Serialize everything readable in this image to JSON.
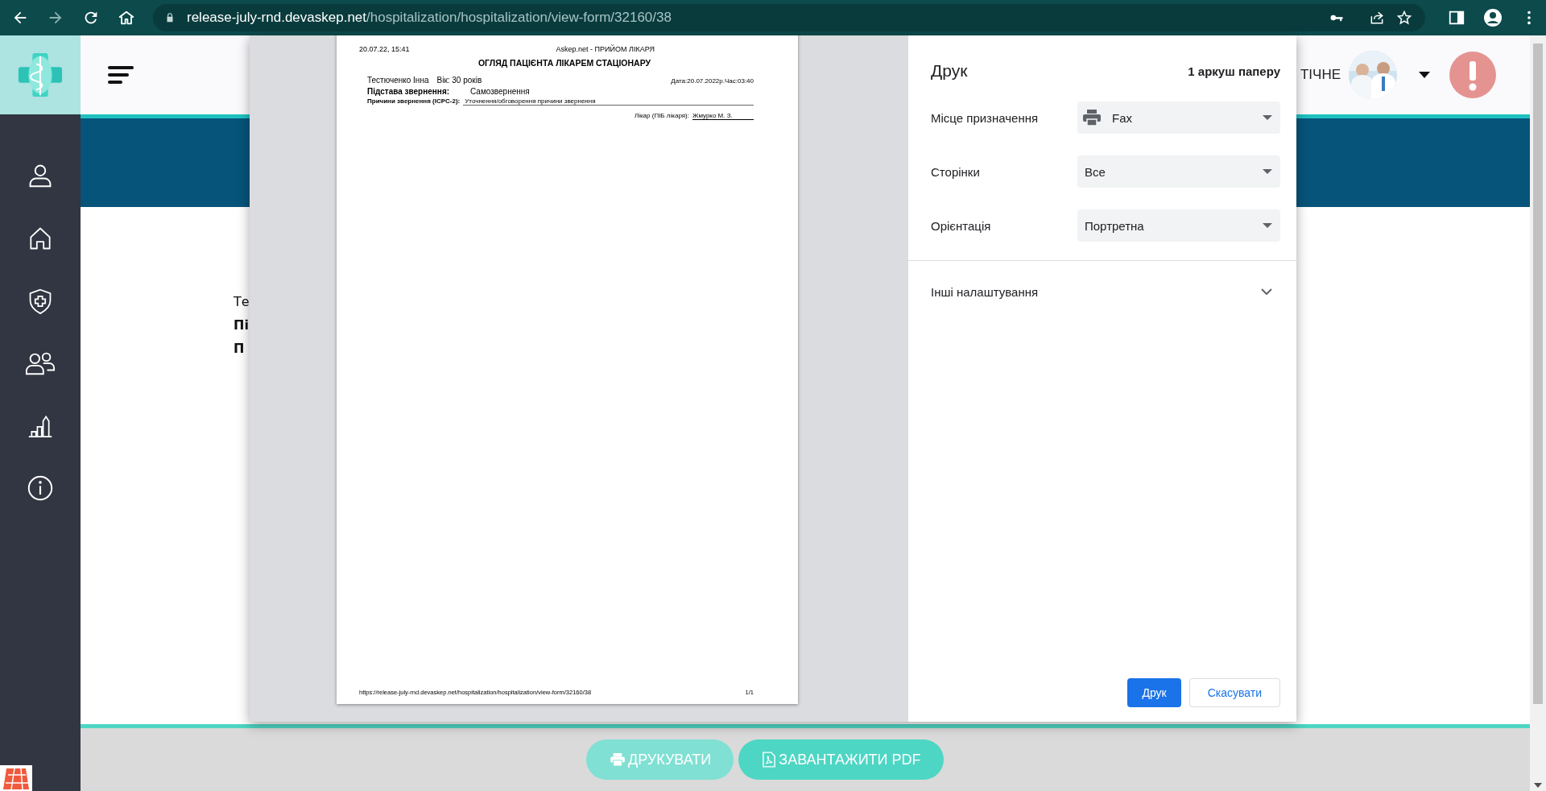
{
  "browser": {
    "url_host": "release-july-rnd.devaskep.net",
    "url_path": "/hospitalization/hospitalization/view-form/32160/38"
  },
  "header": {
    "title_fragment": "ТІЧНЕ"
  },
  "behind_text": [
    {
      "text": "Те",
      "bold": false
    },
    {
      "text": "Пі",
      "bold": true
    },
    {
      "text": "П",
      "bold": true
    }
  ],
  "footer_buttons": [
    {
      "label": "ДРУКУВАТИ",
      "disabled": true
    },
    {
      "label": "ЗАВАНТАЖИТИ PDF",
      "disabled": false
    }
  ],
  "print_preview": {
    "header_left": "20.07.22, 15:41",
    "header_center": "Askep.net - ПРИЙОМ ЛІКАРЯ",
    "title": "ОГЛЯД ПАЦІЄНТА ЛІКАРЕМ СТАЦІОНАРУ",
    "patient_name": "Тестюченко Інна",
    "age": "Вік: 30 років",
    "date": "Дата:20.07.2022р.Час:03:40",
    "basis_label": "Підстава звернення:",
    "basis_value": "Самозвернення",
    "reasons_label": "Причини звернення (ICPC-2):",
    "reasons_value": "Уточнення/обговорення причини звернення",
    "doctor_label": "Лікар (ПІБ лікаря):",
    "doctor_value": "Жмурко М. З.",
    "footer_url": "https://release-july-rnd.devaskep.net/hospitalization/hospitalization/view-form/32160/38",
    "footer_pages": "1/1"
  },
  "print_dialog": {
    "title": "Друк",
    "sheets": "1 аркуш паперу",
    "settings": [
      {
        "label": "Місце призначення",
        "value": "Fax"
      },
      {
        "label": "Сторінки",
        "value": "Все"
      },
      {
        "label": "Орієнтація",
        "value": "Портретна"
      }
    ],
    "more_settings": {
      "label": "Інші налаштування",
      "expanded": false
    },
    "buttons": [
      {
        "label": "Друк",
        "kind": "primary"
      },
      {
        "label": "Скасувати",
        "kind": "secondary"
      }
    ]
  }
}
